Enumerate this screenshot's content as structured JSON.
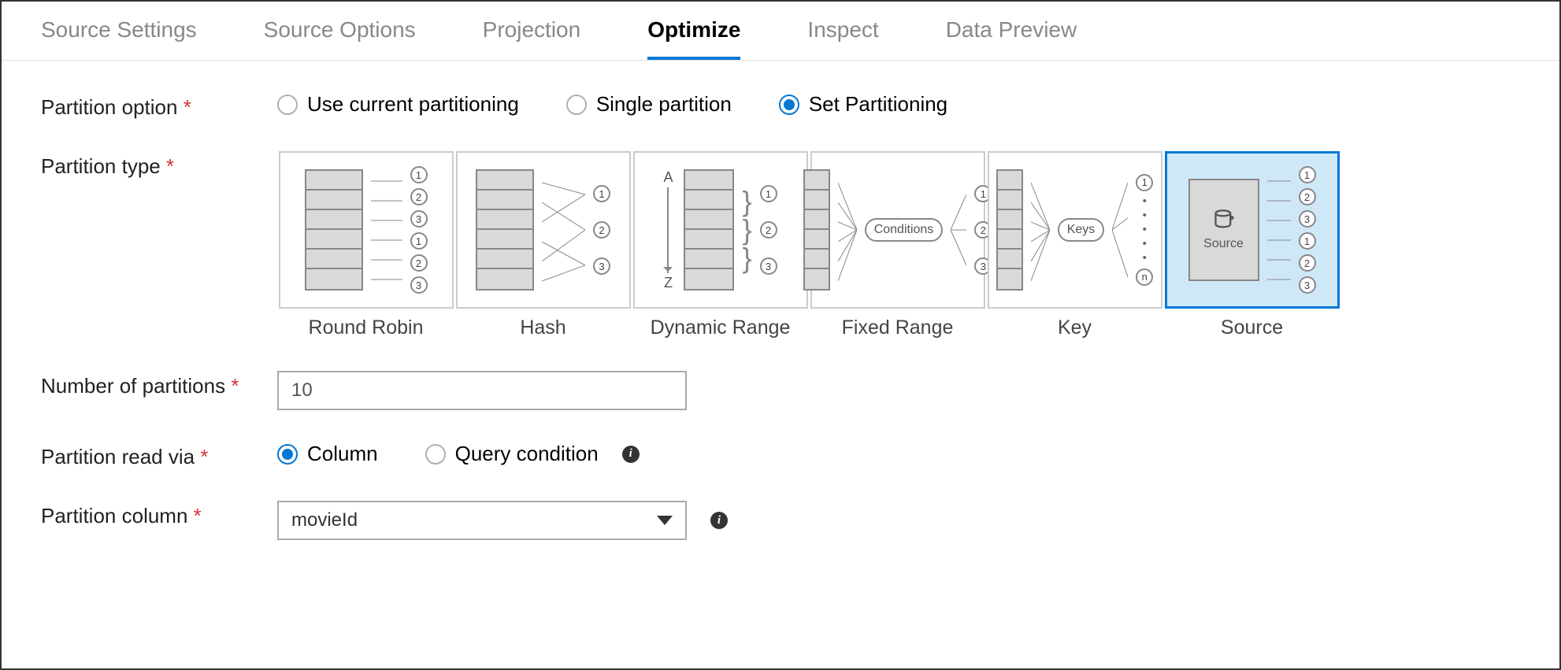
{
  "tabs": {
    "items": [
      "Source Settings",
      "Source Options",
      "Projection",
      "Optimize",
      "Inspect",
      "Data Preview"
    ],
    "activeIndex": 3
  },
  "partitionOption": {
    "label": "Partition option",
    "options": [
      "Use current partitioning",
      "Single partition",
      "Set Partitioning"
    ],
    "selectedIndex": 2
  },
  "partitionType": {
    "label": "Partition type",
    "cards": [
      "Round Robin",
      "Hash",
      "Dynamic Range",
      "Fixed Range",
      "Key",
      "Source"
    ],
    "selectedIndex": 5,
    "sourceCardText": "Source",
    "conditionsOval": "Conditions",
    "keysOval": "Keys"
  },
  "numPartitions": {
    "label": "Number of partitions",
    "value": "10"
  },
  "partitionReadVia": {
    "label": "Partition read via",
    "options": [
      "Column",
      "Query condition"
    ],
    "selectedIndex": 0
  },
  "partitionColumn": {
    "label": "Partition column",
    "value": "movieId"
  }
}
